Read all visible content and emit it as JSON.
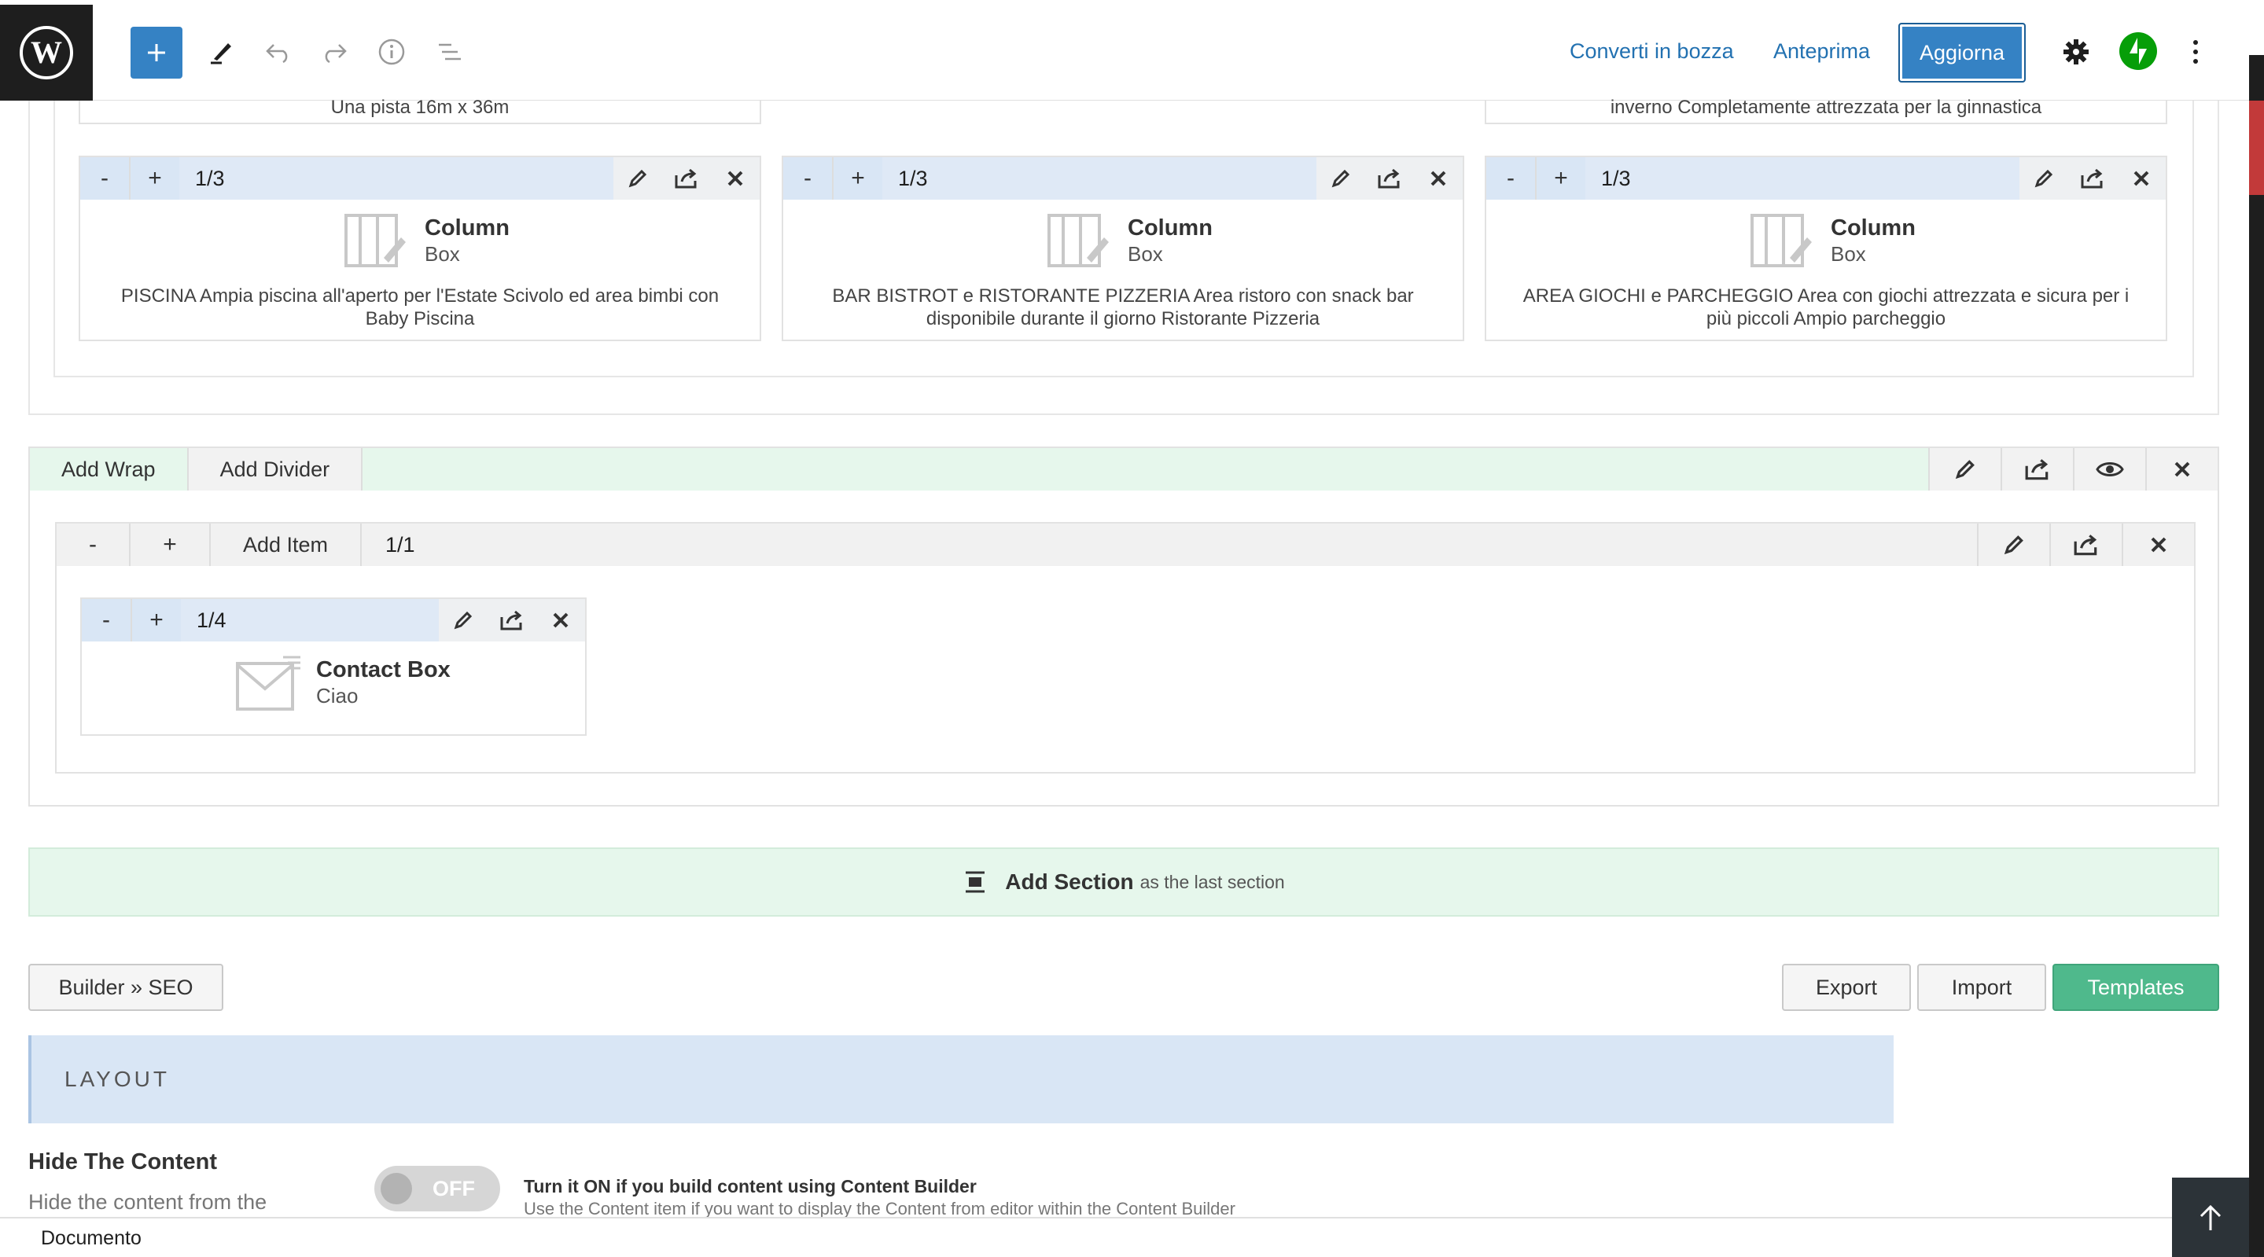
{
  "topbar": {
    "convert_draft": "Converti in bozza",
    "preview": "Anteprima",
    "update": "Aggiorna",
    "icons": [
      "wordpress-logo-icon",
      "plus-icon",
      "pencil-icon",
      "undo-icon",
      "redo-icon",
      "info-icon",
      "list-view-icon",
      "gear-icon",
      "jetpack-icon",
      "more-vertical-icon"
    ]
  },
  "top_row": {
    "left_text": "Una pista 16m x 36m",
    "right_text": "inverno Completamente attrezzata per la ginnastica"
  },
  "columns": [
    {
      "minus": "-",
      "plus": "+",
      "size": "1/3",
      "title": "Column",
      "subtitle": "Box",
      "text": "PISCINA Ampia piscina all'aperto per l'Estate Scivolo ed area bimbi con Baby Piscina"
    },
    {
      "minus": "-",
      "plus": "+",
      "size": "1/3",
      "title": "Column",
      "subtitle": "Box",
      "text": "BAR BISTROT e RISTORANTE PIZZERIA Area ristoro con snack bar disponibile durante il giorno Ristorante Pizzeria"
    },
    {
      "minus": "-",
      "plus": "+",
      "size": "1/3",
      "title": "Column",
      "subtitle": "Box",
      "text": "AREA GIOCHI e PARCHEGGIO Area con giochi attrezzata e sicura per i più piccoli Ampio parcheggio"
    }
  ],
  "section": {
    "add_wrap": "Add Wrap",
    "add_divider": "Add Divider",
    "wrap": {
      "minus": "-",
      "plus": "+",
      "add_item": "Add Item",
      "size": "1/1"
    },
    "item": {
      "minus": "-",
      "plus": "+",
      "size": "1/4",
      "title": "Contact Box",
      "subtitle": "Ciao"
    }
  },
  "add_section": {
    "label": "Add Section",
    "suffix": "as the last section"
  },
  "footer_buttons": {
    "builder_seo": "Builder » SEO",
    "export": "Export",
    "import": "Import",
    "templates": "Templates"
  },
  "layout": {
    "heading": "LAYOUT",
    "option_title": "Hide The Content",
    "option_desc": "Hide the content from the",
    "toggle_state": "OFF",
    "hint_title": "Turn it ON if you build content using Content Builder",
    "hint_desc": "Use the Content item if you want to display the Content from editor within the Content Builder"
  },
  "statusbar": {
    "label": "Documento"
  },
  "colors": {
    "accent": "#3582c4",
    "link": "#2271b1",
    "green": "#4fb98c",
    "blue_bar": "#d9e6f5",
    "jetpack": "#069e08"
  }
}
